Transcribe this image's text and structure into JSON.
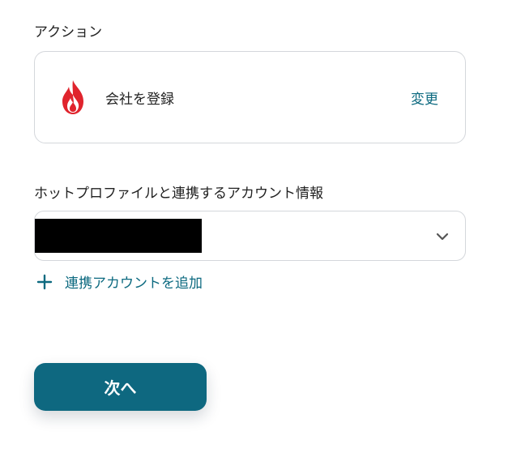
{
  "labels": {
    "action": "アクション",
    "account": "ホットプロファイルと連携するアカウント情報"
  },
  "action_card": {
    "app_icon": "hotprofile-flame-icon",
    "name": "会社を登録",
    "change_label": "変更"
  },
  "account_select": {
    "selected_value_redacted": true,
    "icon": "chevron-down-icon"
  },
  "add_account": {
    "icon": "plus-icon",
    "label": "連携アカウントを追加"
  },
  "next_button": {
    "label": "次へ"
  },
  "colors": {
    "accent": "#0d6a80",
    "button_bg": "#0e6880",
    "border": "#d4d7db",
    "logo_red": "#e0242d"
  }
}
